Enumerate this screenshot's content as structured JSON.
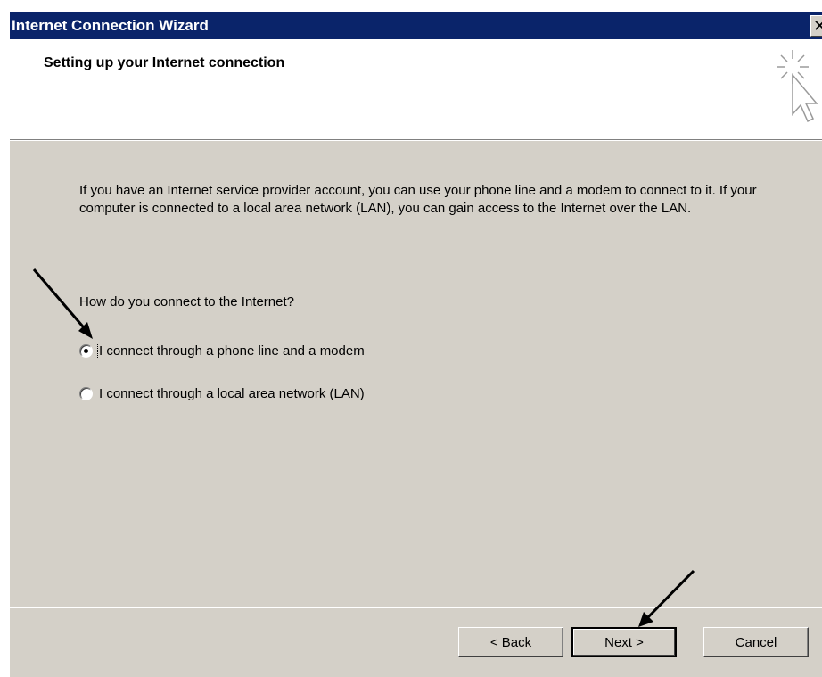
{
  "window": {
    "title": "Internet Connection Wizard",
    "close_glyph": "✕"
  },
  "header": {
    "heading": "Setting up your Internet connection",
    "icon": "wizard-cursor-sparkle-icon"
  },
  "content": {
    "description": "If you have an Internet service provider account, you can use your phone line and a modem to connect to it. If your computer is connected to a local area network (LAN), you can gain access to the Internet over the LAN.",
    "question": "How do you connect to the Internet?",
    "options": [
      {
        "label": "I connect through a phone line and a modem",
        "selected": true
      },
      {
        "label": "I connect through a local area network (LAN)",
        "selected": false
      }
    ]
  },
  "buttons": {
    "back": "< Back",
    "next": "Next >",
    "cancel": "Cancel"
  },
  "annotations": {
    "arrows": [
      "arrow-to-phone-option",
      "arrow-to-next-button"
    ]
  }
}
